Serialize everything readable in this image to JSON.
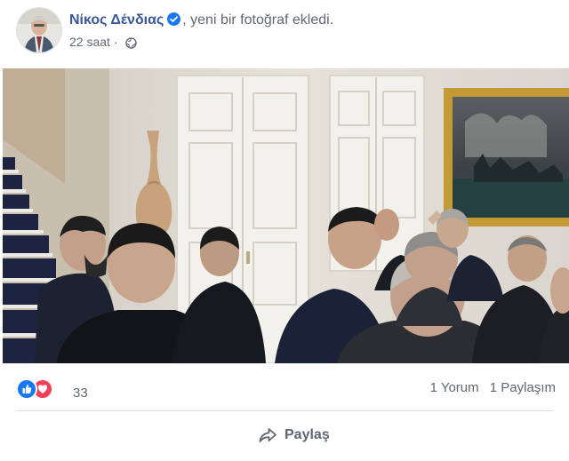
{
  "post": {
    "author": "Νίκος Δένδιας",
    "action": ", yeni bir fotoğraf ekledi.",
    "time": "22 saat",
    "separator": "·",
    "privacy_icon": "globe-icon",
    "verified_icon": "verified-badge-icon"
  },
  "stats": {
    "reaction_icons": [
      "like-icon",
      "love-icon"
    ],
    "reaction_count": "33",
    "comments": "1 Yorum",
    "shares": "1 Paylaşım"
  },
  "actions": {
    "share_label": "Paylaş",
    "share_icon": "share-arrow-icon"
  },
  "colors": {
    "author_link": "#385898",
    "verified": "#1877f2",
    "like": "#1877f2",
    "love": "#f33e58",
    "muted_text": "#606770"
  }
}
